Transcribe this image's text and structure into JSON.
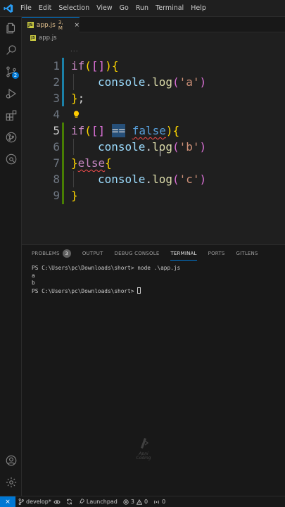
{
  "menu": [
    "File",
    "Edit",
    "Selection",
    "View",
    "Go",
    "Run",
    "Terminal",
    "Help"
  ],
  "activity": {
    "scm_badge": "2"
  },
  "tab": {
    "name": "app.js",
    "status": "3, M",
    "close": "×",
    "icon": "JS"
  },
  "breadcrumb": {
    "file": "app.js",
    "icon": "JS"
  },
  "sticky_dots": "...",
  "code": {
    "line_numbers": [
      "1",
      "2",
      "3",
      "4",
      "5",
      "6",
      "7",
      "8",
      "9"
    ],
    "l1": {
      "kw": "if",
      "p1": "(",
      "b1": "[",
      "b2": "]",
      "p2": ")",
      "brace": "{"
    },
    "l2": {
      "obj": "console",
      "dot": ".",
      "fn": "log",
      "p1": "(",
      "str": "'a'",
      "p2": ")"
    },
    "l3": {
      "brace": "}",
      "semi": ";"
    },
    "l5": {
      "kw": "if",
      "p1": "(",
      "b1": "[",
      "b2": "]",
      "op": "==",
      "val": "false",
      "p2": ")",
      "brace": "{"
    },
    "l6": {
      "obj": "console",
      "dot": ".",
      "fn": "log",
      "p1": "(",
      "str": "'b'",
      "p2": ")"
    },
    "l7": {
      "brace": "}",
      "kw": "else",
      "brace2": "{"
    },
    "l8": {
      "obj": "console",
      "dot": ".",
      "fn": "log",
      "p1": "(",
      "str": "'c'",
      "p2": ")"
    },
    "l9": {
      "brace": "}"
    }
  },
  "panel": {
    "tabs": [
      "PROBLEMS",
      "OUTPUT",
      "DEBUG CONSOLE",
      "TERMINAL",
      "PORTS",
      "GITLENS"
    ],
    "problems_count": "3",
    "terminal_lines": [
      "PS C:\\Users\\pc\\Downloads\\short> node .\\app.js",
      "a",
      "b",
      "PS C:\\Users\\pc\\Downloads\\short> "
    ]
  },
  "watermark": {
    "line1": "Apni",
    "line2": "Coding"
  },
  "status": {
    "remote": "⨯",
    "branch": "develop*",
    "launchpad": "Launchpad",
    "errors": "3",
    "warnings": "0",
    "ports": "0"
  }
}
